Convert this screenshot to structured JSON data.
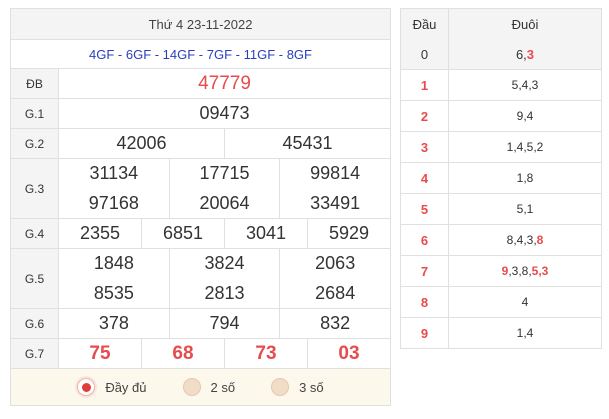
{
  "header": {
    "date": "Thứ 4 23-11-2022",
    "codes": "4GF - 6GF - 14GF - 7GF - 11GF - 8GF"
  },
  "prizes": {
    "db": {
      "label": "ĐB",
      "values": [
        "47779"
      ]
    },
    "g1": {
      "label": "G.1",
      "values": [
        "09473"
      ]
    },
    "g2": {
      "label": "G.2",
      "values": [
        "42006",
        "45431"
      ]
    },
    "g3": {
      "label": "G.3",
      "values": [
        "31134",
        "17715",
        "99814",
        "97168",
        "20064",
        "33491"
      ]
    },
    "g4": {
      "label": "G.4",
      "values": [
        "2355",
        "6851",
        "3041",
        "5929"
      ]
    },
    "g5": {
      "label": "G.5",
      "values": [
        "1848",
        "3824",
        "2063",
        "8535",
        "2813",
        "2684"
      ]
    },
    "g6": {
      "label": "G.6",
      "values": [
        "378",
        "794",
        "832"
      ]
    },
    "g7": {
      "label": "G.7",
      "values": [
        "75",
        "68",
        "73",
        "03"
      ]
    }
  },
  "options": [
    {
      "label": "Đầy đủ",
      "selected": true
    },
    {
      "label": "2 số",
      "selected": false
    },
    {
      "label": "3 số",
      "selected": false
    }
  ],
  "loto": {
    "head_label": "Đầu",
    "tail_label": "Đuôi",
    "rows": [
      {
        "head": "0",
        "tail": [
          {
            "t": "6,"
          },
          {
            "t": "3",
            "red": true
          }
        ]
      },
      {
        "head": "1",
        "tail": [
          {
            "t": "5,4,3"
          }
        ]
      },
      {
        "head": "2",
        "tail": [
          {
            "t": "9,4"
          }
        ]
      },
      {
        "head": "3",
        "tail": [
          {
            "t": "1,4,5,2"
          }
        ]
      },
      {
        "head": "4",
        "tail": [
          {
            "t": "1,8"
          }
        ]
      },
      {
        "head": "5",
        "tail": [
          {
            "t": "5,1"
          }
        ]
      },
      {
        "head": "6",
        "tail": [
          {
            "t": "8,4,3,"
          },
          {
            "t": "8",
            "red": true
          }
        ]
      },
      {
        "head": "7",
        "tail": [
          {
            "t": "9",
            "red": true
          },
          {
            "t": ",3,8,"
          },
          {
            "t": "5,3",
            "red": true
          }
        ]
      },
      {
        "head": "8",
        "tail": [
          {
            "t": "4"
          }
        ]
      },
      {
        "head": "9",
        "tail": [
          {
            "t": "1,4"
          }
        ]
      }
    ]
  },
  "colors": {
    "accent_red": "#e74c4c",
    "code_blue": "#2a3fbf",
    "radio_selected": "#e23c3c"
  }
}
